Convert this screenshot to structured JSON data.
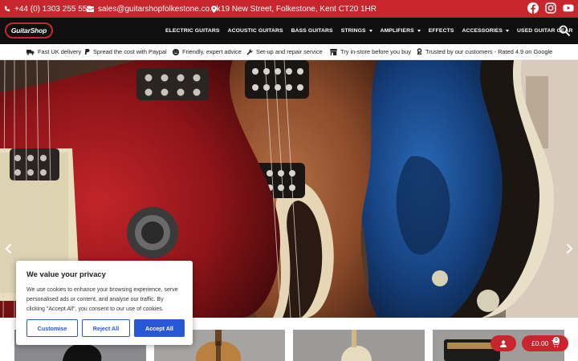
{
  "topbar": {
    "phone": "+44 (0) 1303 255 558",
    "email": "sales@guitarshopfolkestone.co.uk",
    "address": "19 New Street, Folkestone, Kent CT20 1HR",
    "socials": [
      "facebook-icon",
      "instagram-icon",
      "youtube-icon"
    ]
  },
  "logo": {
    "text": "GuitarShop"
  },
  "nav": {
    "items": [
      {
        "label": "ELECTRIC GUITARS",
        "dropdown": false
      },
      {
        "label": "ACOUSTIC GUITARS",
        "dropdown": false
      },
      {
        "label": "BASS GUITARS",
        "dropdown": false
      },
      {
        "label": "STRINGS",
        "dropdown": true
      },
      {
        "label": "AMPLIFIERS",
        "dropdown": true
      },
      {
        "label": "EFFECTS",
        "dropdown": false
      },
      {
        "label": "ACCESSORIES",
        "dropdown": true
      },
      {
        "label": "USED GUITAR GEAR",
        "dropdown": false
      }
    ]
  },
  "usp": {
    "items": [
      {
        "icon": "truck-icon",
        "label": "Fast UK delivery"
      },
      {
        "icon": "paypal-icon",
        "label": "Spread the cost with Paypal"
      },
      {
        "icon": "smile-icon",
        "label": "Friendly, expert advice"
      },
      {
        "icon": "wrench-icon",
        "label": "Set-up and repair service"
      },
      {
        "icon": "store-icon",
        "label": "Try in-store before you buy"
      },
      {
        "icon": "award-icon",
        "label": "Trusted by our customers - Rated 4.9 on Google"
      }
    ]
  },
  "cookie": {
    "title": "We value your privacy",
    "body": "We use cookies to enhance your browsing experience, serve personalised ads or content, and analyse our traffic. By clicking \"Accept All\", you consent to our use of cookies.",
    "customise": "Customise",
    "reject": "Reject All",
    "accept": "Accept All"
  },
  "cart": {
    "total": "£0.00",
    "count": "0"
  },
  "colors": {
    "brand": "#c8252c",
    "nav_bg": "#0f0f0f",
    "cookie_accent": "#2759d6"
  }
}
